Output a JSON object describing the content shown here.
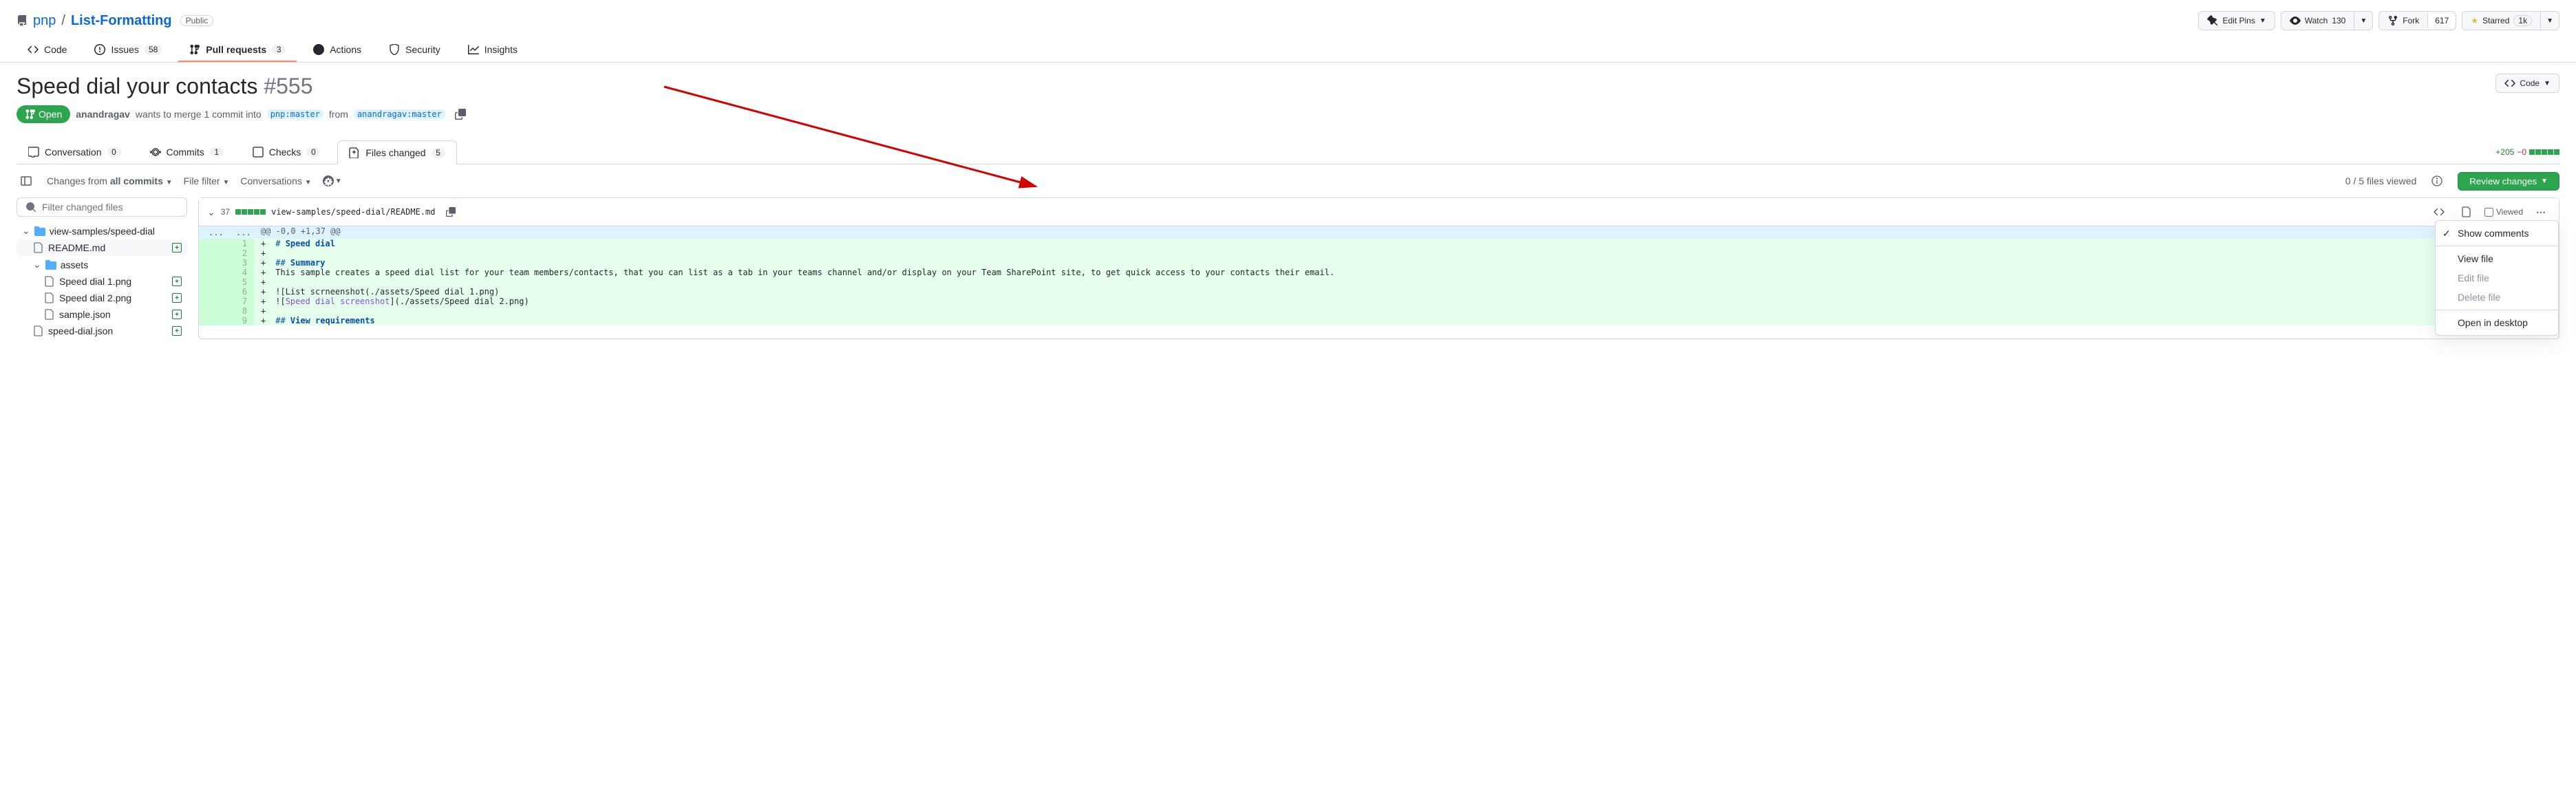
{
  "repo": {
    "owner": "pnp",
    "name": "List-Formatting",
    "visibility": "Public"
  },
  "repoActions": {
    "editPins": "Edit Pins",
    "watch": "Watch",
    "watchCount": "130",
    "fork": "Fork",
    "forkCount": "617",
    "starred": "Starred",
    "starCount": "1k"
  },
  "repoNav": {
    "code": "Code",
    "issues": "Issues",
    "issuesCount": "58",
    "pulls": "Pull requests",
    "pullsCount": "3",
    "actions": "Actions",
    "security": "Security",
    "insights": "Insights"
  },
  "pr": {
    "title": "Speed dial your contacts",
    "number": "#555",
    "state": "Open",
    "author": "anandragav",
    "mergeText1": "wants to merge 1 commit into",
    "baseBranch": "pnp:master",
    "fromText": "from",
    "headBranch": "anandragav:master",
    "codeBtn": "Code"
  },
  "prTabs": {
    "conversation": "Conversation",
    "conversationCount": "0",
    "commits": "Commits",
    "commitsCount": "1",
    "checks": "Checks",
    "checksCount": "0",
    "files": "Files changed",
    "filesCount": "5",
    "additions": "+205",
    "deletions": "−0"
  },
  "toolbar": {
    "changesFrom": "Changes from",
    "allCommits": "all commits",
    "fileFilter": "File filter",
    "conversations": "Conversations",
    "viewedStatus": "0 / 5 files viewed",
    "reviewChanges": "Review changes"
  },
  "search": {
    "placeholder": "Filter changed files"
  },
  "tree": {
    "root": "view-samples/speed-dial",
    "files": [
      {
        "name": "README.md",
        "added": true,
        "selected": true
      },
      {
        "name": "assets",
        "folder": true
      },
      {
        "name": "Speed dial 1.png",
        "added": true,
        "indent": 2
      },
      {
        "name": "Speed dial 2.png",
        "added": true,
        "indent": 2
      },
      {
        "name": "sample.json",
        "added": true,
        "indent": 2
      },
      {
        "name": "speed-dial.json",
        "added": true,
        "indent": 1
      }
    ]
  },
  "diff": {
    "lineCount": "37",
    "path": "view-samples/speed-dial/README.md",
    "viewed": "Viewed",
    "hunk": "@@ -0,0 +1,37 @@",
    "lines": [
      {
        "n": "1",
        "text": "# Speed dial",
        "md": true
      },
      {
        "n": "2",
        "text": ""
      },
      {
        "n": "3",
        "text": "## Summary",
        "md": true
      },
      {
        "n": "4",
        "text": "This sample creates a speed dial list for your team members/contacts, that you can list as a tab in your teams channel and/or display on your Team SharePoint site, to get quick access to your contacts their email."
      },
      {
        "n": "5",
        "text": ""
      },
      {
        "n": "6",
        "text": "![List scrneenshot(./assets/Speed dial 1.png)"
      },
      {
        "n": "7",
        "text": "![Speed dial screenshot](./assets/Speed dial 2.png)",
        "link": true
      },
      {
        "n": "8",
        "text": ""
      },
      {
        "n": "9",
        "text": "## View requirements",
        "md": true
      }
    ]
  },
  "menu": {
    "showComments": "Show comments",
    "viewFile": "View file",
    "editFile": "Edit file",
    "deleteFile": "Delete file",
    "openDesktop": "Open in desktop"
  }
}
